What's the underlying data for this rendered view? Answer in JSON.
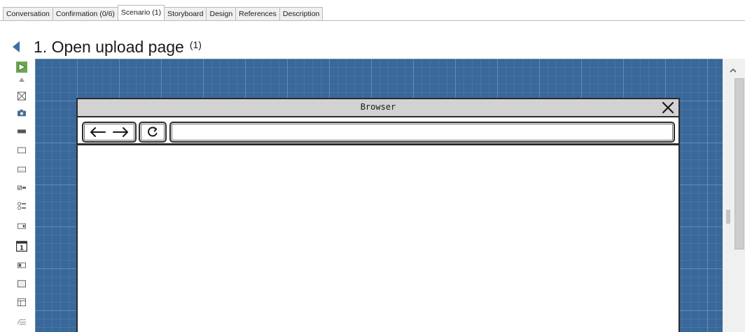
{
  "tabs": [
    {
      "label": "Conversation",
      "active": false
    },
    {
      "label": "Confirmation (0/6)",
      "active": false
    },
    {
      "label": "Scenario (1)",
      "active": true
    },
    {
      "label": "Storyboard",
      "active": false
    },
    {
      "label": "Design",
      "active": false
    },
    {
      "label": "References",
      "active": false
    },
    {
      "label": "Description",
      "active": false
    }
  ],
  "header": {
    "title": "1. Open upload page",
    "count": "(1)"
  },
  "toolbar": {
    "tools": [
      "play-icon",
      "collapse-arrow-icon",
      "image-placeholder-icon",
      "camera-icon",
      "bar-icon",
      "rectangle-icon",
      "text-field-icon",
      "checkbox-list-icon",
      "radio-list-icon",
      "dropdown-icon",
      "calendar-icon",
      "toggle-icon",
      "panel-icon",
      "table-icon",
      "text-area-icon"
    ]
  },
  "browser": {
    "title": "Browser",
    "address_value": ""
  },
  "colors": {
    "canvas": "#39689a",
    "accent": "#3c6ea8",
    "frame": "#2b2b2b"
  }
}
